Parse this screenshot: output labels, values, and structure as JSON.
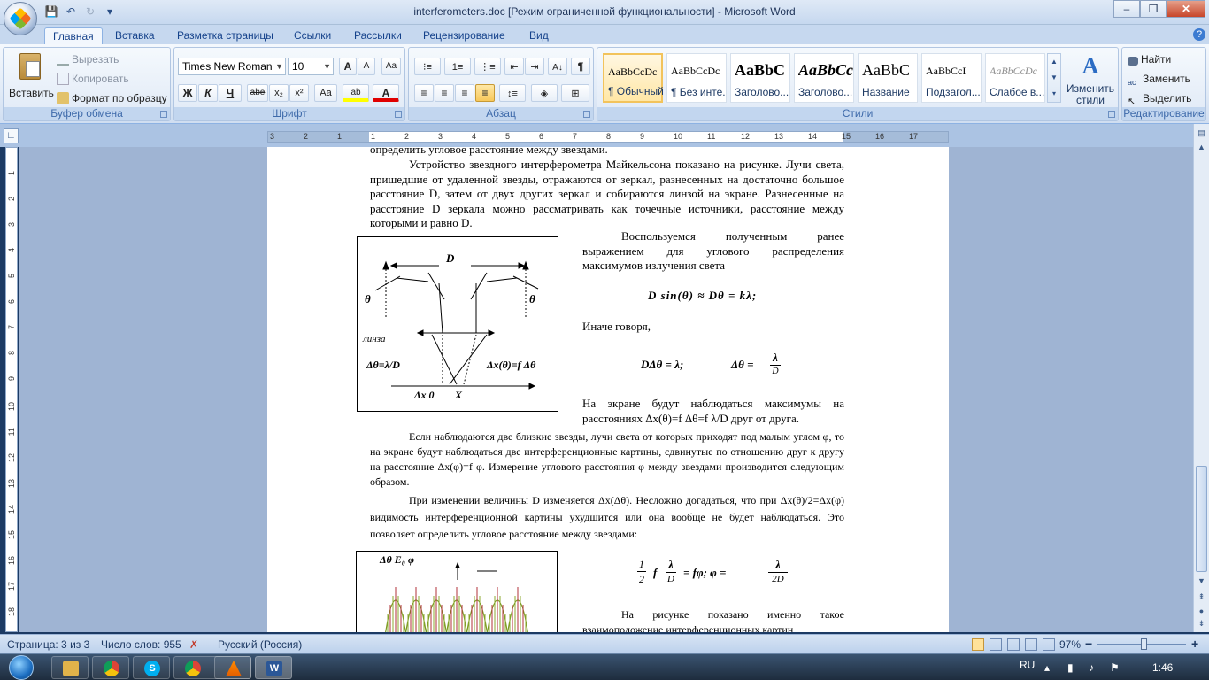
{
  "window": {
    "title": "interferometers.doc [Режим ограниченной функциональности] - Microsoft Word",
    "controls": {
      "minimize": "–",
      "maximize": "❐",
      "close": "✕"
    }
  },
  "qat": {
    "save": "💾",
    "undo": "↶",
    "redo": "↻",
    "customize": "▾"
  },
  "tabs": [
    "Главная",
    "Вставка",
    "Разметка страницы",
    "Ссылки",
    "Рассылки",
    "Рецензирование",
    "Вид"
  ],
  "help_icon": "?",
  "clipboard": {
    "paste": "Вставить",
    "cut": "Вырезать",
    "copy": "Копировать",
    "format_painter": "Формат по образцу",
    "label": "Буфер обмена"
  },
  "font": {
    "name": "Times New Roman",
    "size": "10",
    "label": "Шрифт",
    "grow": "A",
    "shrink": "A",
    "clear": "Aa",
    "bold": "Ж",
    "italic": "К",
    "underline": "Ч",
    "strike": "abe",
    "sub": "x₂",
    "sup": "x²",
    "case": "Aa",
    "highlight": "ab",
    "color": "A"
  },
  "paragraph": {
    "label": "Абзац",
    "pilcrow": "¶"
  },
  "styles": {
    "label": "Стили",
    "items": [
      {
        "sample": "AaBbCcDc",
        "name": "¶ Обычный"
      },
      {
        "sample": "AaBbCcDc",
        "name": "¶ Без инте..."
      },
      {
        "sample": "AaBbC",
        "name": "Заголово..."
      },
      {
        "sample": "AaBbCc",
        "name": "Заголово..."
      },
      {
        "sample": "AaBbC",
        "name": "Название"
      },
      {
        "sample": "AaBbCcI",
        "name": "Подзагол..."
      },
      {
        "sample": "AaBbCcDc",
        "name": "Слабое в..."
      }
    ],
    "change_styles": "Изменить стили"
  },
  "editing": {
    "label": "Редактирование",
    "find": "Найти",
    "replace": "Заменить",
    "select": "Выделить"
  },
  "ruler": {
    "h_ticks": [
      "3",
      "2",
      "1",
      "1",
      "2",
      "3",
      "4",
      "5",
      "6",
      "7",
      "8",
      "9",
      "10",
      "11",
      "12",
      "13",
      "14",
      "15",
      "16",
      "17"
    ],
    "v_ticks": [
      "1",
      "2",
      "3",
      "4",
      "5",
      "6",
      "7",
      "8",
      "9",
      "10",
      "11",
      "12",
      "13",
      "14",
      "15",
      "16",
      "17",
      "18"
    ]
  },
  "document": {
    "line0": "определить угловое расстояние между звездами.",
    "para1": "Устройство звездного интерферометра Майкельсона показано на рисунке. Лучи света, пришедшие от удаленной звезды, отражаются от зеркал, разнесенных на достаточно большое расстояние D, затем от двух других зеркал и собираются линзой на экране. Разнесенные на расстояние D зеркала можно рассматривать как точечные источники, расстояние между которыми и равно D.",
    "para2": "Воспользуемся полученным ранее выражением для углового распределения максимумов излучения света",
    "formula1": "D sin(θ) ≈ Dθ = kλ;",
    "para3": "Иначе говоря,",
    "formula2a": "DΔθ = λ;",
    "formula2b": "Δθ =",
    "formula2_num": "λ",
    "formula2_den": "D",
    "para4": "На экране будут наблюдаться максимумы на расстояниях  Δx(θ)=f Δθ=f λ/D  друг от друга.",
    "para5": "Если наблюдаются две близкие звезды, лучи света от которых приходят под малым углом φ, то на экране будут наблюдаться две интерференционные картины, сдвинутые по отношению друг к другу на расстояние  Δx(φ)=f φ. Измерение углового расстояния φ между звездами производится следующим образом.",
    "para6": "При изменении величины D изменяется  Δx(Δθ). Несложно догадаться, что при Δx(θ)/2=Δx(φ) видимость интерференционной картины ухудшится или она вообще не будет наблюдаться. Это позволяет определить угловое расстояние между звездами:",
    "formula3": {
      "half_num": "1",
      "half_den": "2",
      "f": "f",
      "lam": "λ",
      "d": "D",
      "rest": "= fφ;  φ =",
      "lam2": "λ",
      "d2": "2D"
    },
    "para7": "На рисунке показано именно такое взаимоположение интерференционных картин,",
    "fig1": {
      "d_label": "D",
      "theta_left": "θ",
      "theta_right": "θ",
      "lens": "линза",
      "eq_left": "Δθ=λ/D",
      "eq_right": "Δx(θ)=f Δθ",
      "x0": "Δx 0",
      "x": "X"
    },
    "fig2": {
      "header": "Δθ E₀   φ"
    }
  },
  "status": {
    "page": "Страница: 3 из 3",
    "words": "Число слов: 955",
    "lang": "Русский (Россия)",
    "zoom": "97%",
    "zoom_minus": "−",
    "zoom_plus": "+"
  },
  "taskbar": {
    "lang": "RU",
    "time": "1:46",
    "apps": [
      "explorer",
      "chrome",
      "skype",
      "chrome",
      "vlc",
      "word"
    ]
  }
}
